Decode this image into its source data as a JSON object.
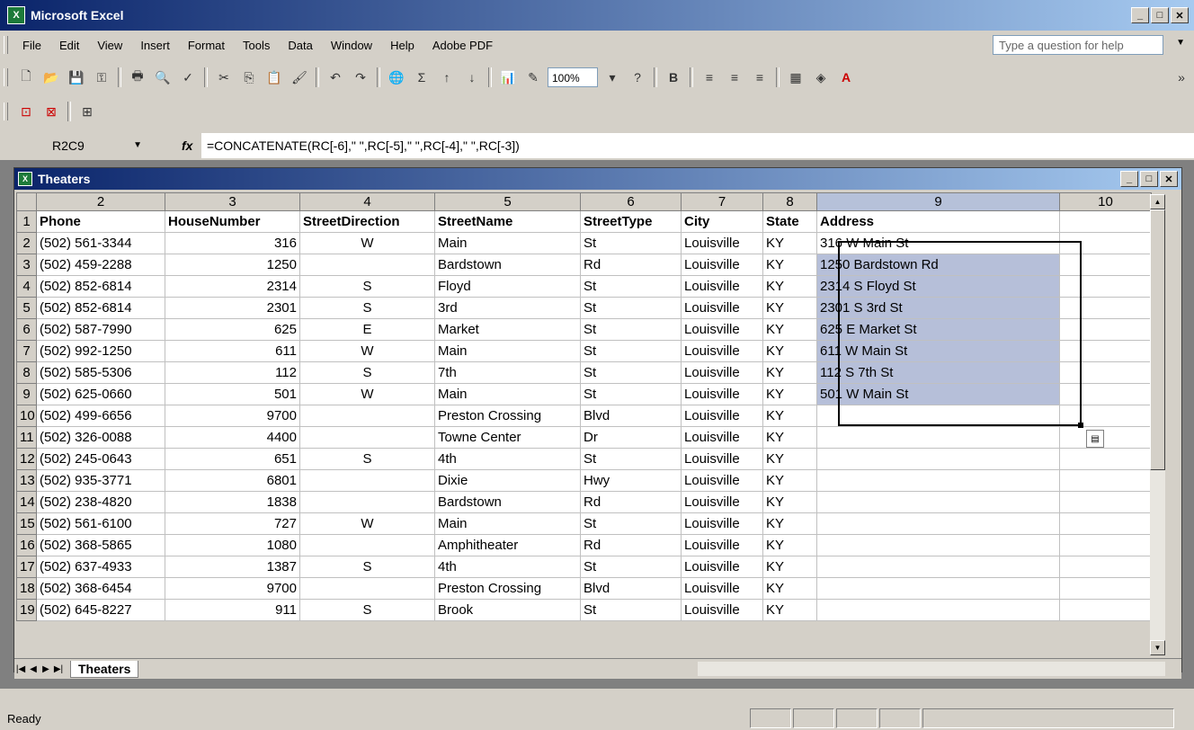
{
  "app": {
    "title": "Microsoft Excel"
  },
  "menu": [
    "File",
    "Edit",
    "View",
    "Insert",
    "Format",
    "Tools",
    "Data",
    "Window",
    "Help",
    "Adobe PDF"
  ],
  "help_placeholder": "Type a question for help",
  "toolbar": {
    "zoom": "100%",
    "bold": "B"
  },
  "formula_bar": {
    "name_box": "R2C9",
    "fx": "fx",
    "formula": "=CONCATENATE(RC[-6],\" \",RC[-5],\" \",RC[-4],\" \",RC[-3])"
  },
  "sheet_window": {
    "title": "Theaters"
  },
  "grid": {
    "columns": [
      "2",
      "3",
      "4",
      "5",
      "6",
      "7",
      "8",
      "9",
      "10"
    ],
    "header_row": [
      "Phone",
      "HouseNumber",
      "StreetDirection",
      "StreetName",
      "StreetType",
      "City",
      "State",
      "Address"
    ],
    "rows": [
      {
        "n": "2",
        "phone": "(502) 561-3344",
        "house": "316",
        "dir": "W",
        "street": "Main",
        "type": "St",
        "city": "Louisville",
        "state": "KY",
        "address": "316 W Main St"
      },
      {
        "n": "3",
        "phone": "(502) 459-2288",
        "house": "1250",
        "dir": "",
        "street": "Bardstown",
        "type": "Rd",
        "city": "Louisville",
        "state": "KY",
        "address": "1250  Bardstown Rd"
      },
      {
        "n": "4",
        "phone": "(502) 852-6814",
        "house": "2314",
        "dir": "S",
        "street": "Floyd",
        "type": "St",
        "city": "Louisville",
        "state": "KY",
        "address": "2314 S Floyd St"
      },
      {
        "n": "5",
        "phone": "(502) 852-6814",
        "house": "2301",
        "dir": "S",
        "street": "3rd",
        "type": "St",
        "city": "Louisville",
        "state": "KY",
        "address": "2301 S 3rd St"
      },
      {
        "n": "6",
        "phone": "(502) 587-7990",
        "house": "625",
        "dir": "E",
        "street": "Market",
        "type": "St",
        "city": "Louisville",
        "state": "KY",
        "address": "625 E Market St"
      },
      {
        "n": "7",
        "phone": "(502) 992-1250",
        "house": "611",
        "dir": "W",
        "street": "Main",
        "type": "St",
        "city": "Louisville",
        "state": "KY",
        "address": "611 W Main St"
      },
      {
        "n": "8",
        "phone": "(502) 585-5306",
        "house": "112",
        "dir": "S",
        "street": "7th",
        "type": "St",
        "city": "Louisville",
        "state": "KY",
        "address": "112 S 7th St"
      },
      {
        "n": "9",
        "phone": "(502) 625-0660",
        "house": "501",
        "dir": "W",
        "street": "Main",
        "type": "St",
        "city": "Louisville",
        "state": "KY",
        "address": "501 W Main St"
      },
      {
        "n": "10",
        "phone": "(502) 499-6656",
        "house": "9700",
        "dir": "",
        "street": "Preston Crossing",
        "type": "Blvd",
        "city": "Louisville",
        "state": "KY",
        "address": ""
      },
      {
        "n": "11",
        "phone": "(502) 326-0088",
        "house": "4400",
        "dir": "",
        "street": "Towne Center",
        "type": "Dr",
        "city": "Louisville",
        "state": "KY",
        "address": ""
      },
      {
        "n": "12",
        "phone": "(502) 245-0643",
        "house": "651",
        "dir": "S",
        "street": "4th",
        "type": "St",
        "city": "Louisville",
        "state": "KY",
        "address": ""
      },
      {
        "n": "13",
        "phone": "(502) 935-3771",
        "house": "6801",
        "dir": "",
        "street": "Dixie",
        "type": "Hwy",
        "city": "Louisville",
        "state": "KY",
        "address": ""
      },
      {
        "n": "14",
        "phone": "(502) 238-4820",
        "house": "1838",
        "dir": "",
        "street": "Bardstown",
        "type": "Rd",
        "city": "Louisville",
        "state": "KY",
        "address": ""
      },
      {
        "n": "15",
        "phone": "(502) 561-6100",
        "house": "727",
        "dir": "W",
        "street": "Main",
        "type": "St",
        "city": "Louisville",
        "state": "KY",
        "address": ""
      },
      {
        "n": "16",
        "phone": "(502) 368-5865",
        "house": "1080",
        "dir": "",
        "street": "Amphitheater",
        "type": "Rd",
        "city": "Louisville",
        "state": "KY",
        "address": ""
      },
      {
        "n": "17",
        "phone": "(502) 637-4933",
        "house": "1387",
        "dir": "S",
        "street": "4th",
        "type": "St",
        "city": "Louisville",
        "state": "KY",
        "address": ""
      },
      {
        "n": "18",
        "phone": "(502) 368-6454",
        "house": "9700",
        "dir": "",
        "street": "Preston Crossing",
        "type": "Blvd",
        "city": "Louisville",
        "state": "KY",
        "address": ""
      },
      {
        "n": "19",
        "phone": "(502) 645-8227",
        "house": "911",
        "dir": "S",
        "street": "Brook",
        "type": "St",
        "city": "Louisville",
        "state": "KY",
        "address": ""
      }
    ]
  },
  "sheet_tab": "Theaters",
  "status": {
    "text": "Ready"
  },
  "colors": {
    "title_dark": "#0a246a",
    "title_light": "#a6caf0",
    "selection": "#b6bfd9"
  }
}
